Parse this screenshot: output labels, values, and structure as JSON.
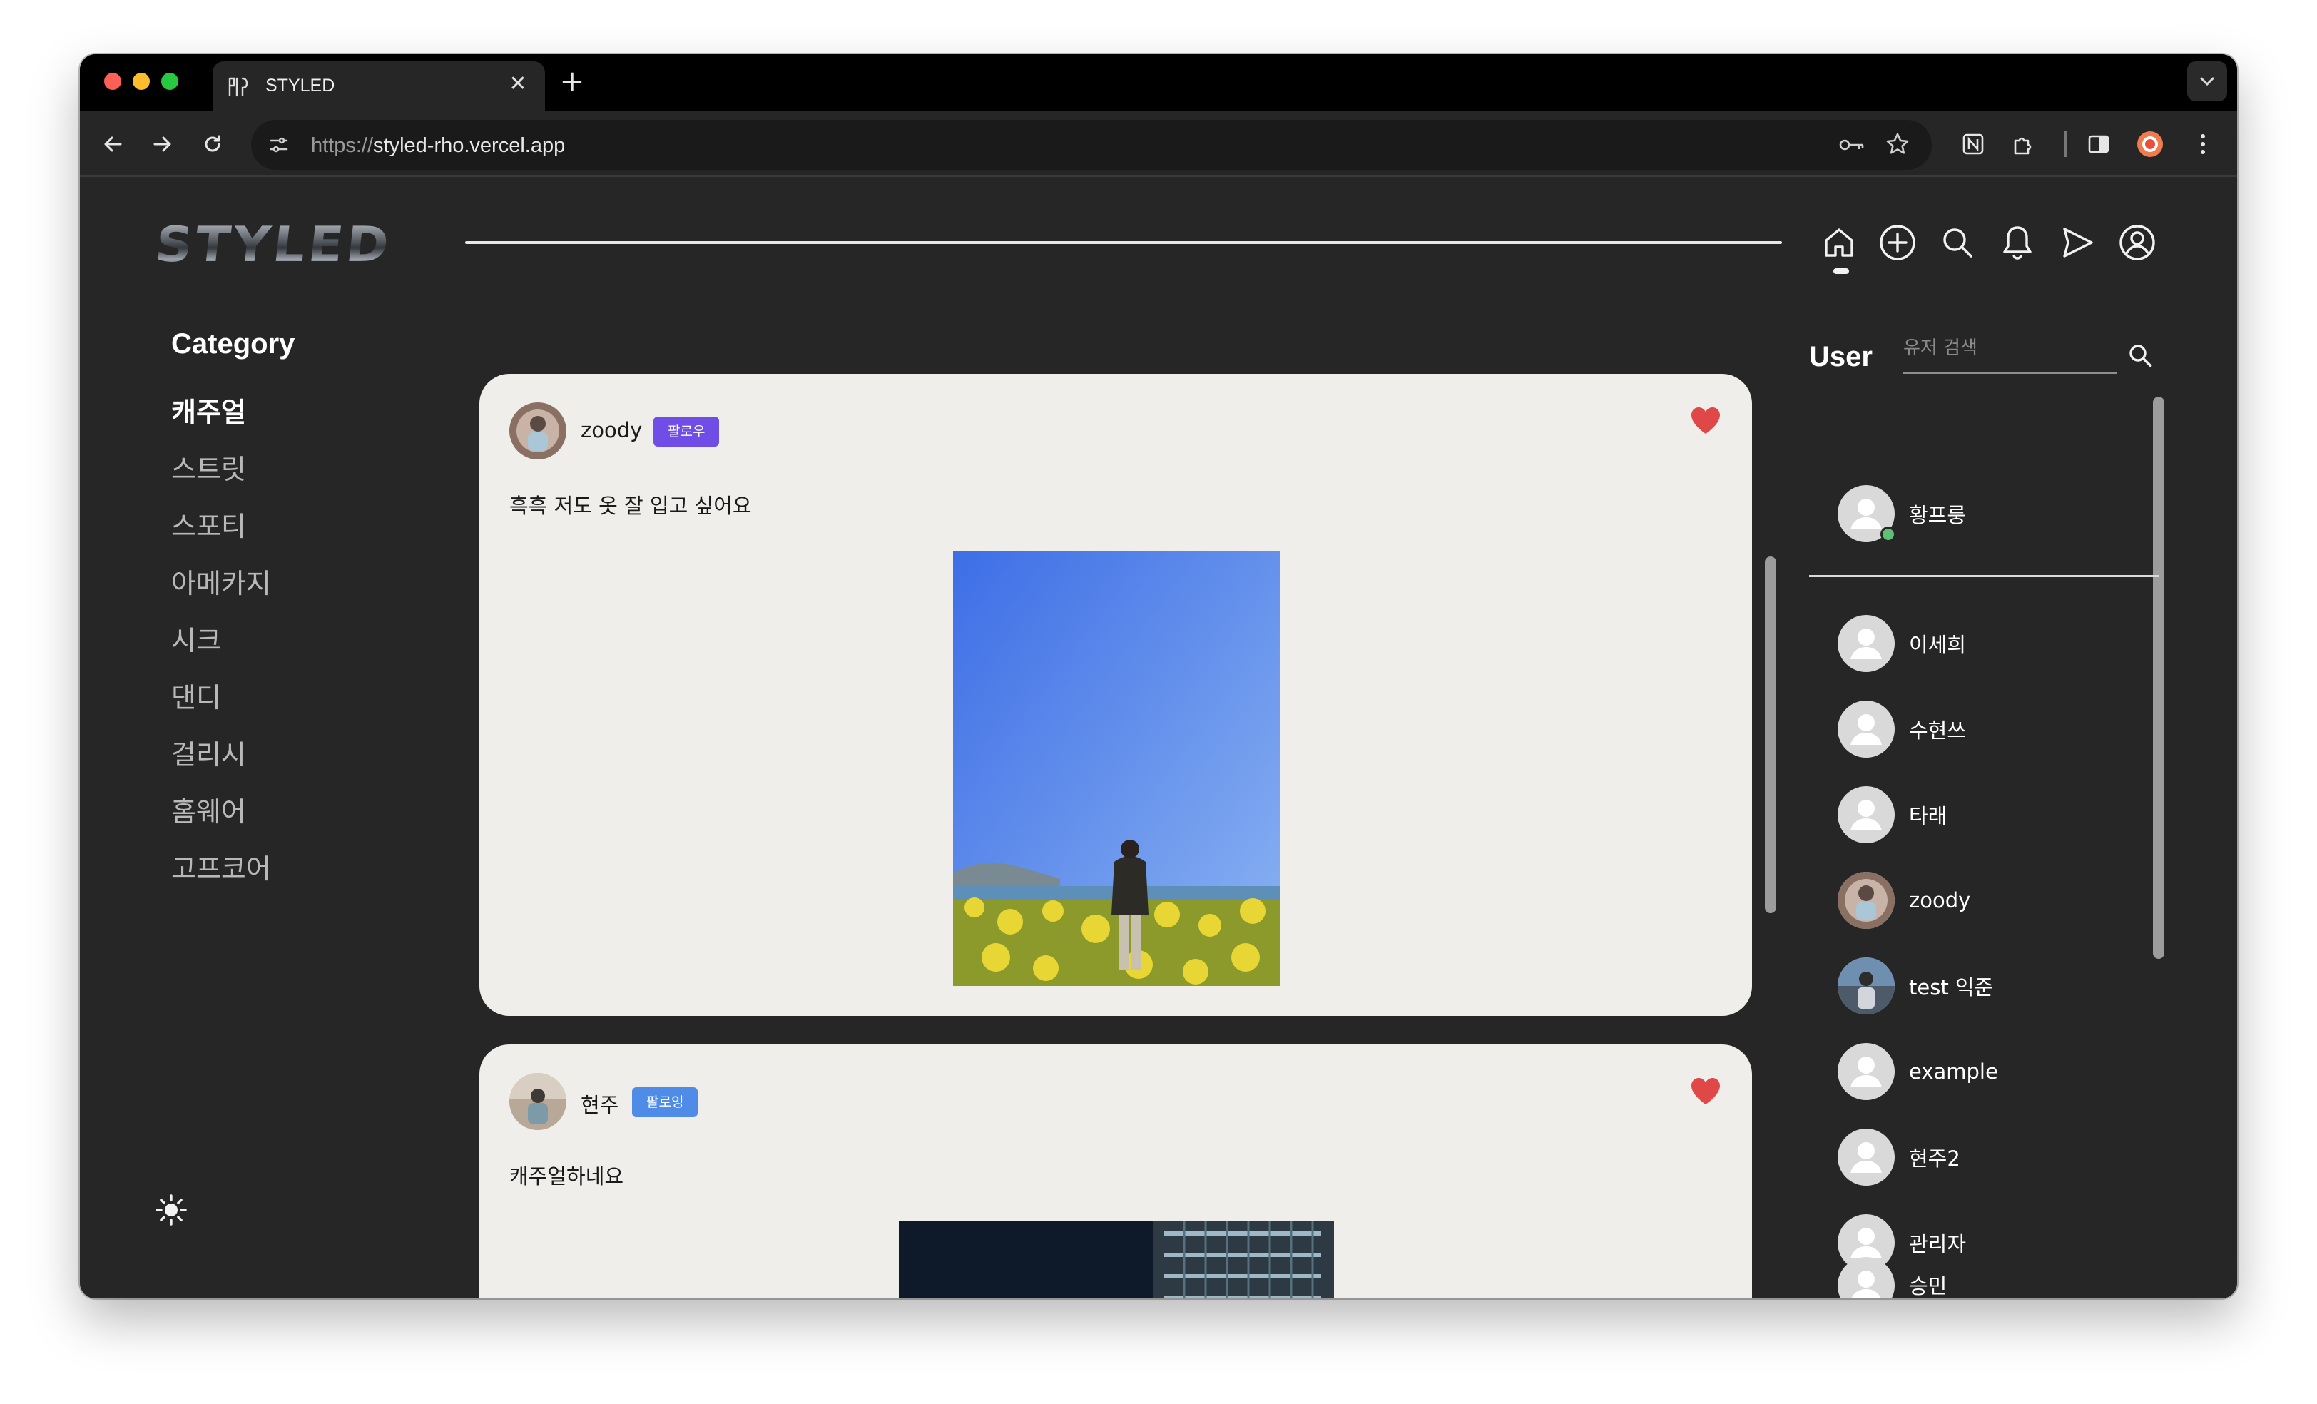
{
  "browser": {
    "tab_title": "STYLED",
    "url_prefix": "https://",
    "url_host": "styled-rho.vercel.app",
    "new_tab": "+",
    "close": "✕"
  },
  "header": {
    "logo": "STYLED",
    "nav": [
      {
        "name": "home",
        "icon": "home-icon",
        "active": true
      },
      {
        "name": "create",
        "icon": "plus-circle-icon"
      },
      {
        "name": "search",
        "icon": "search-icon"
      },
      {
        "name": "notifications",
        "icon": "bell-icon"
      },
      {
        "name": "messages",
        "icon": "send-icon"
      },
      {
        "name": "profile",
        "icon": "user-circle-icon"
      }
    ]
  },
  "category": {
    "title": "Category",
    "items": [
      "캐주얼",
      "스트릿",
      "스포티",
      "아메카지",
      "시크",
      "댄디",
      "걸리시",
      "홈웨어",
      "고프코어"
    ],
    "active": "캐주얼"
  },
  "posts": [
    {
      "author": "zoody",
      "badge": "팔로우",
      "badge_color": "#6f4de6",
      "text": "흑흑 저도 옷 잘 입고 싶어요",
      "liked": true
    },
    {
      "author": "현주",
      "badge": "팔로잉",
      "badge_color": "#4f8ce8",
      "text": "캐주얼하네요",
      "liked": true
    }
  ],
  "users_panel": {
    "title": "User",
    "search_placeholder": "유저 검색",
    "me": {
      "name": "황프룽",
      "online": true
    },
    "list": [
      "이세희",
      "수현쓰",
      "타래",
      "zoody",
      "test 익준",
      "example",
      "현주2",
      "관리자",
      "승민"
    ]
  },
  "colors": {
    "page_bg": "#262626",
    "card_bg": "#f0eeeb",
    "heart": "#e04848",
    "online": "#5fbf73"
  }
}
